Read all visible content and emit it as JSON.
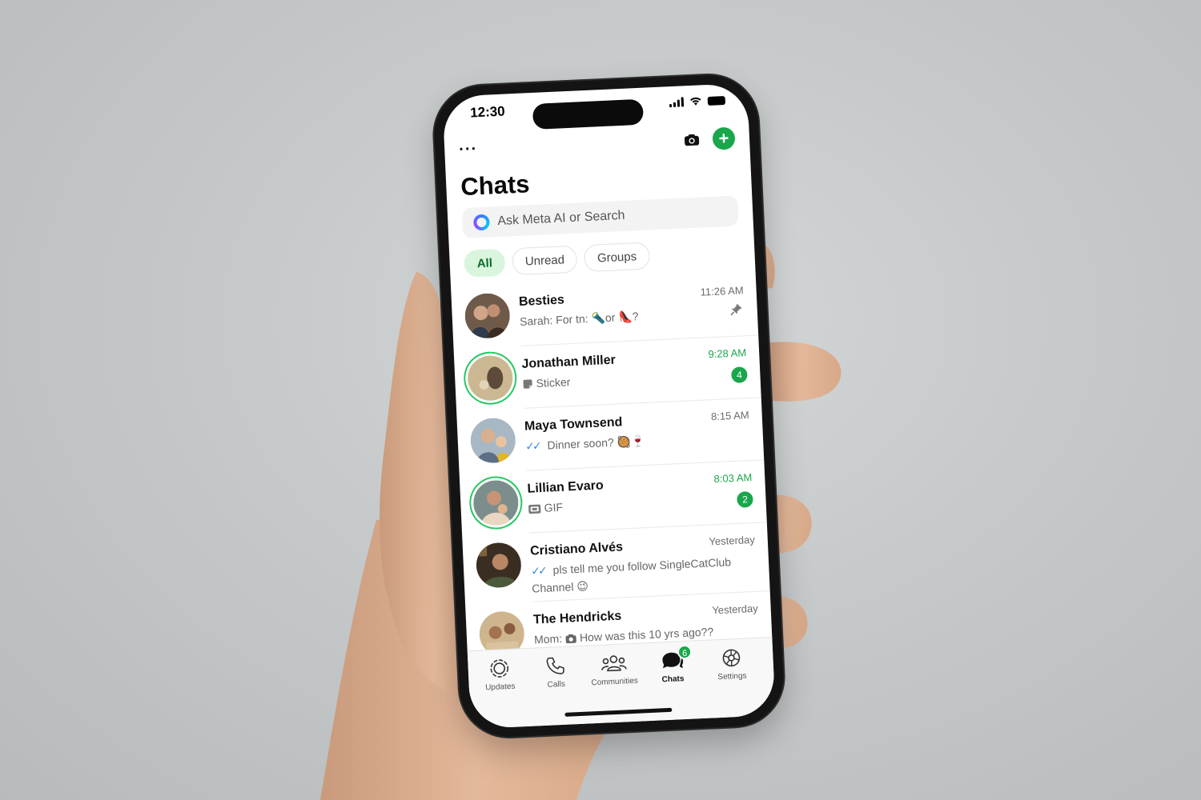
{
  "status_bar": {
    "time": "12:30"
  },
  "header": {
    "more_label": "···",
    "new_chat_label": "+",
    "title": "Chats"
  },
  "search": {
    "placeholder": "Ask Meta AI or Search"
  },
  "filters": [
    {
      "label": "All",
      "active": true
    },
    {
      "label": "Unread",
      "active": false
    },
    {
      "label": "Groups",
      "active": false
    }
  ],
  "chats": [
    {
      "name": "Besties",
      "time": "11:26 AM",
      "preview_sender": "Sarah:",
      "preview_text": "For tn: 🔦or 👠?",
      "pinned": true,
      "unread": null
    },
    {
      "name": "Jonathan Miller",
      "time": "9:28 AM",
      "preview_text": "Sticker",
      "unread": "4"
    },
    {
      "name": "Maya Townsend",
      "time": "8:15 AM",
      "preview_text": "Dinner soon? 🥘🍷",
      "unread": null
    },
    {
      "name": "Lillian Evaro",
      "time": "8:03 AM",
      "preview_text": "GIF",
      "unread": "2"
    },
    {
      "name": "Cristiano Alvés",
      "time": "Yesterday",
      "preview_text": "pls tell me you follow SingleCatClub Channel 😉",
      "unread": null
    },
    {
      "name": "The Hendricks",
      "time": "Yesterday",
      "preview_sender": "Mom:",
      "preview_text": "How was this 10 yrs ago??",
      "unread": null
    }
  ],
  "tabs": [
    {
      "label": "Updates",
      "icon": "updates-icon"
    },
    {
      "label": "Calls",
      "icon": "phone-icon"
    },
    {
      "label": "Communities",
      "icon": "communities-icon"
    },
    {
      "label": "Chats",
      "icon": "chats-icon",
      "active": true,
      "badge": "6"
    },
    {
      "label": "Settings",
      "icon": "gear-icon"
    }
  ],
  "colors": {
    "accent": "#1aa64b",
    "chip_active_bg": "#d9f5de",
    "read_tick": "#3a8dde"
  }
}
